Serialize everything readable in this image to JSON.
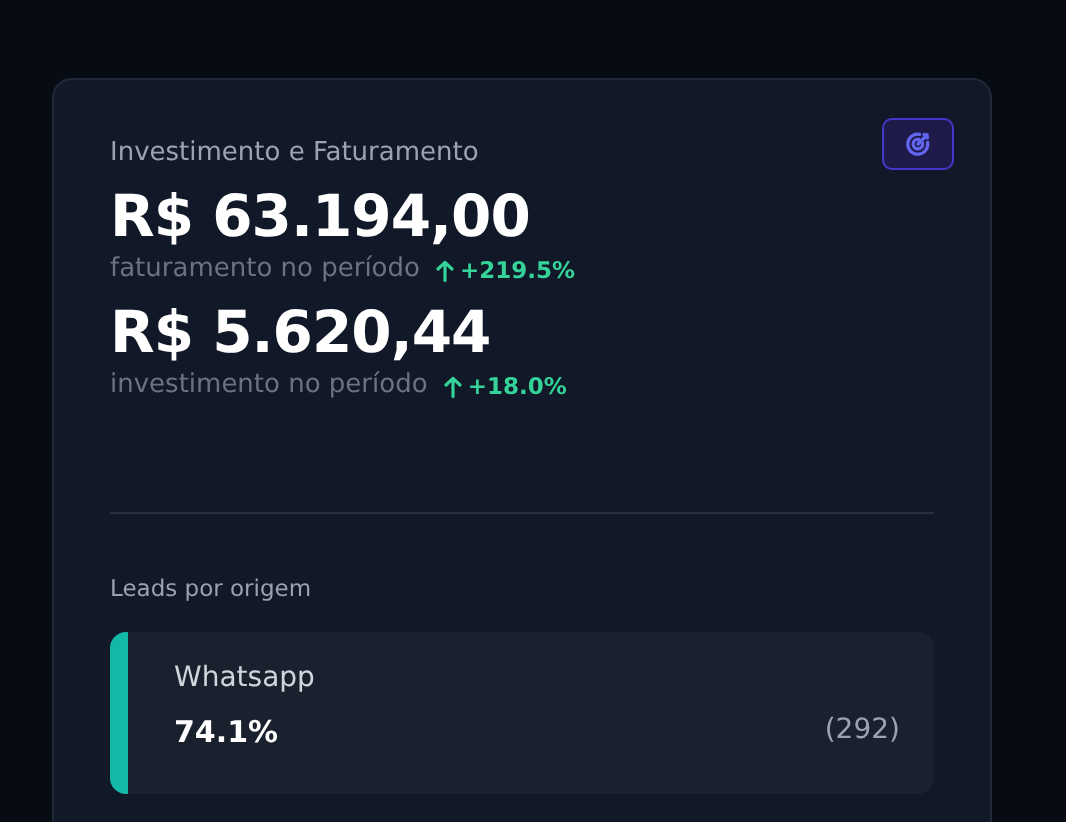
{
  "card": {
    "title": "Investimento e Faturamento",
    "metrics": [
      {
        "value": "R$ 63.194,00",
        "label": "faturamento no período",
        "change": "+219.5%"
      },
      {
        "value": "R$ 5.620,44",
        "label": "investimento no período",
        "change": "+18.0%"
      }
    ]
  },
  "leads": {
    "title": "Leads por origem",
    "items": [
      {
        "name": "Whatsapp",
        "percent": "74.1%",
        "count": "(292)",
        "color": "#14b8a6"
      }
    ]
  }
}
